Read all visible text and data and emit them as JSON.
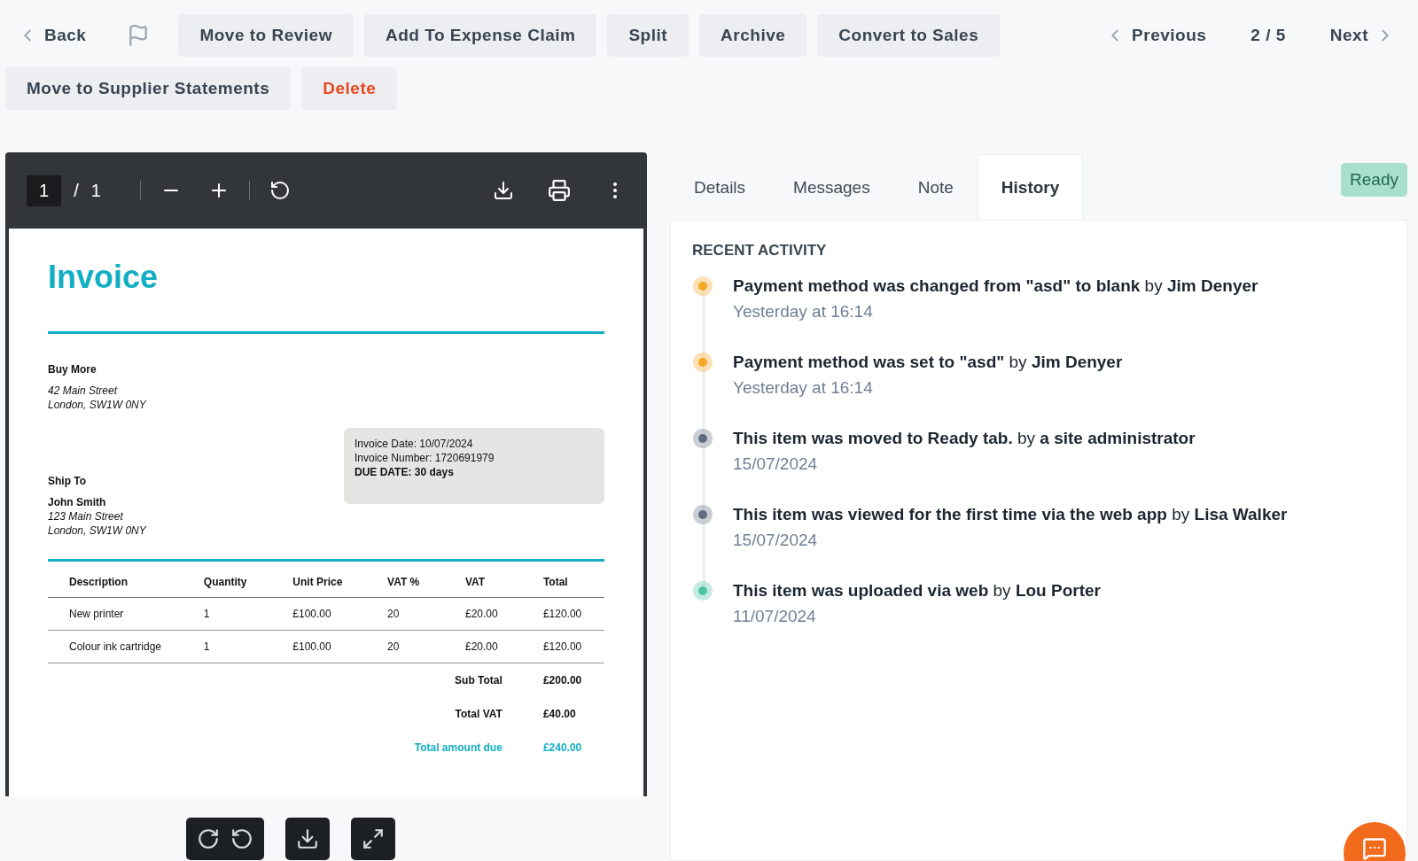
{
  "toolbar": {
    "back": "Back",
    "flagged": false,
    "actions": [
      {
        "label": "Move to Review",
        "kind": "normal"
      },
      {
        "label": "Add To Expense Claim",
        "kind": "normal"
      },
      {
        "label": "Split",
        "kind": "normal"
      },
      {
        "label": "Archive",
        "kind": "normal"
      },
      {
        "label": "Convert to Sales",
        "kind": "normal"
      },
      {
        "label": "Move to Supplier Statements",
        "kind": "normal"
      },
      {
        "label": "Delete",
        "kind": "danger"
      }
    ],
    "previous": "Previous",
    "position": "2 / 5",
    "next": "Next"
  },
  "viewer": {
    "page": "1",
    "separator": "/",
    "pages": "1"
  },
  "invoice": {
    "title": "Invoice",
    "seller": {
      "name": "Buy More",
      "address": [
        "42 Main Street",
        "London, SW1W 0NY"
      ]
    },
    "meta": [
      {
        "text": "Invoice Date: 10/07/2024",
        "kind": "plain"
      },
      {
        "text": "Invoice Number: 1720691979",
        "kind": "plain"
      },
      {
        "text": "DUE DATE: 30 days",
        "kind": "bold"
      }
    ],
    "ship_to": {
      "heading": "Ship To",
      "name": "John Smith",
      "address": [
        "123 Main Street",
        "London, SW1W 0NY"
      ]
    },
    "columns": [
      "Description",
      "Quantity",
      "Unit Price",
      "VAT %",
      "VAT",
      "Total"
    ],
    "rows": [
      [
        "New printer",
        "1",
        "£100.00",
        "20",
        "£20.00",
        "£120.00"
      ],
      [
        "Colour ink cartridge",
        "1",
        "£100.00",
        "20",
        "£20.00",
        "£120.00"
      ]
    ],
    "totals": [
      {
        "label": "Sub Total",
        "value": "£200.00",
        "kind": "plain"
      },
      {
        "label": "Total VAT",
        "value": "£40.00",
        "kind": "plain"
      },
      {
        "label": "Total amount due",
        "value": "£240.00",
        "kind": "accent"
      }
    ]
  },
  "tabs": [
    {
      "label": "Details",
      "selected": false
    },
    {
      "label": "Messages",
      "selected": false
    },
    {
      "label": "Note",
      "selected": false
    },
    {
      "label": "History",
      "selected": true
    }
  ],
  "status": "Ready",
  "activity": {
    "heading": "RECENT ACTIVITY",
    "items": [
      {
        "text": "**Payment method was changed from \"asd\" to blank** by **Jim Denyer**",
        "time": "Yesterday at 16:14",
        "color": "#f5a623"
      },
      {
        "text": "**Payment method was set to \"asd\"** by **Jim Denyer**",
        "time": "Yesterday at 16:14",
        "color": "#f5a623"
      },
      {
        "text": "**This item was moved to Ready tab.** by **a site administrator**",
        "time": "15/07/2024",
        "color": "#5f6b7d"
      },
      {
        "text": "**This item was viewed for the first time via the web app** by **Lisa Walker**",
        "time": "15/07/2024",
        "color": "#5f6b7d"
      },
      {
        "text": "**This item was uploaded via web** by **Lou Porter**",
        "time": "11/07/2024",
        "color": "#4fc3a1"
      }
    ]
  }
}
